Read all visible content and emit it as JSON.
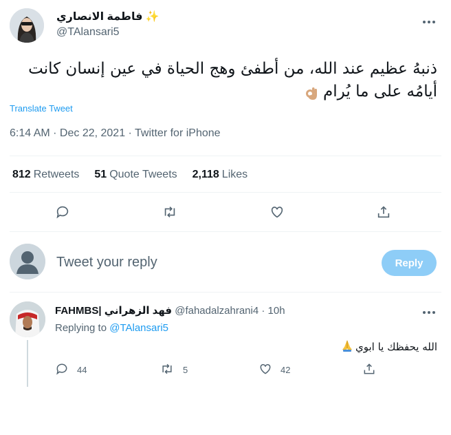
{
  "author": {
    "name": "فاطمة الانصاري ✨",
    "handle": "@TAlansari5"
  },
  "tweet": {
    "text": "ذنبهُ عظيم عند الله، من أطفئ وهج الحياة في عين إنسان كانت أيامُه على ما يُرام",
    "emoji": "ok-hand-icon",
    "translate_label": "Translate Tweet",
    "timestamp": "6:14 AM · Dec 22, 2021 · Twitter for iPhone"
  },
  "stats": {
    "retweets_count": "812",
    "retweets_label": "Retweets",
    "quotes_count": "51",
    "quotes_label": "Quote Tweets",
    "likes_count": "2,118",
    "likes_label": "Likes"
  },
  "compose": {
    "placeholder": "Tweet your reply",
    "button_label": "Reply"
  },
  "comment": {
    "name": "FAHMBS| فهد الزهراني",
    "handle": "@fahadalzahrani4",
    "time": "· 10h",
    "replying_prefix": "Replying to",
    "replying_to": "@TAlansari5",
    "text": "الله يحفظك يا ابوي",
    "replies": "44",
    "retweets": "5",
    "likes": "42"
  },
  "colors": {
    "accent": "#1d9bf0",
    "button_disabled": "#8ecdf7",
    "muted": "#536471"
  }
}
